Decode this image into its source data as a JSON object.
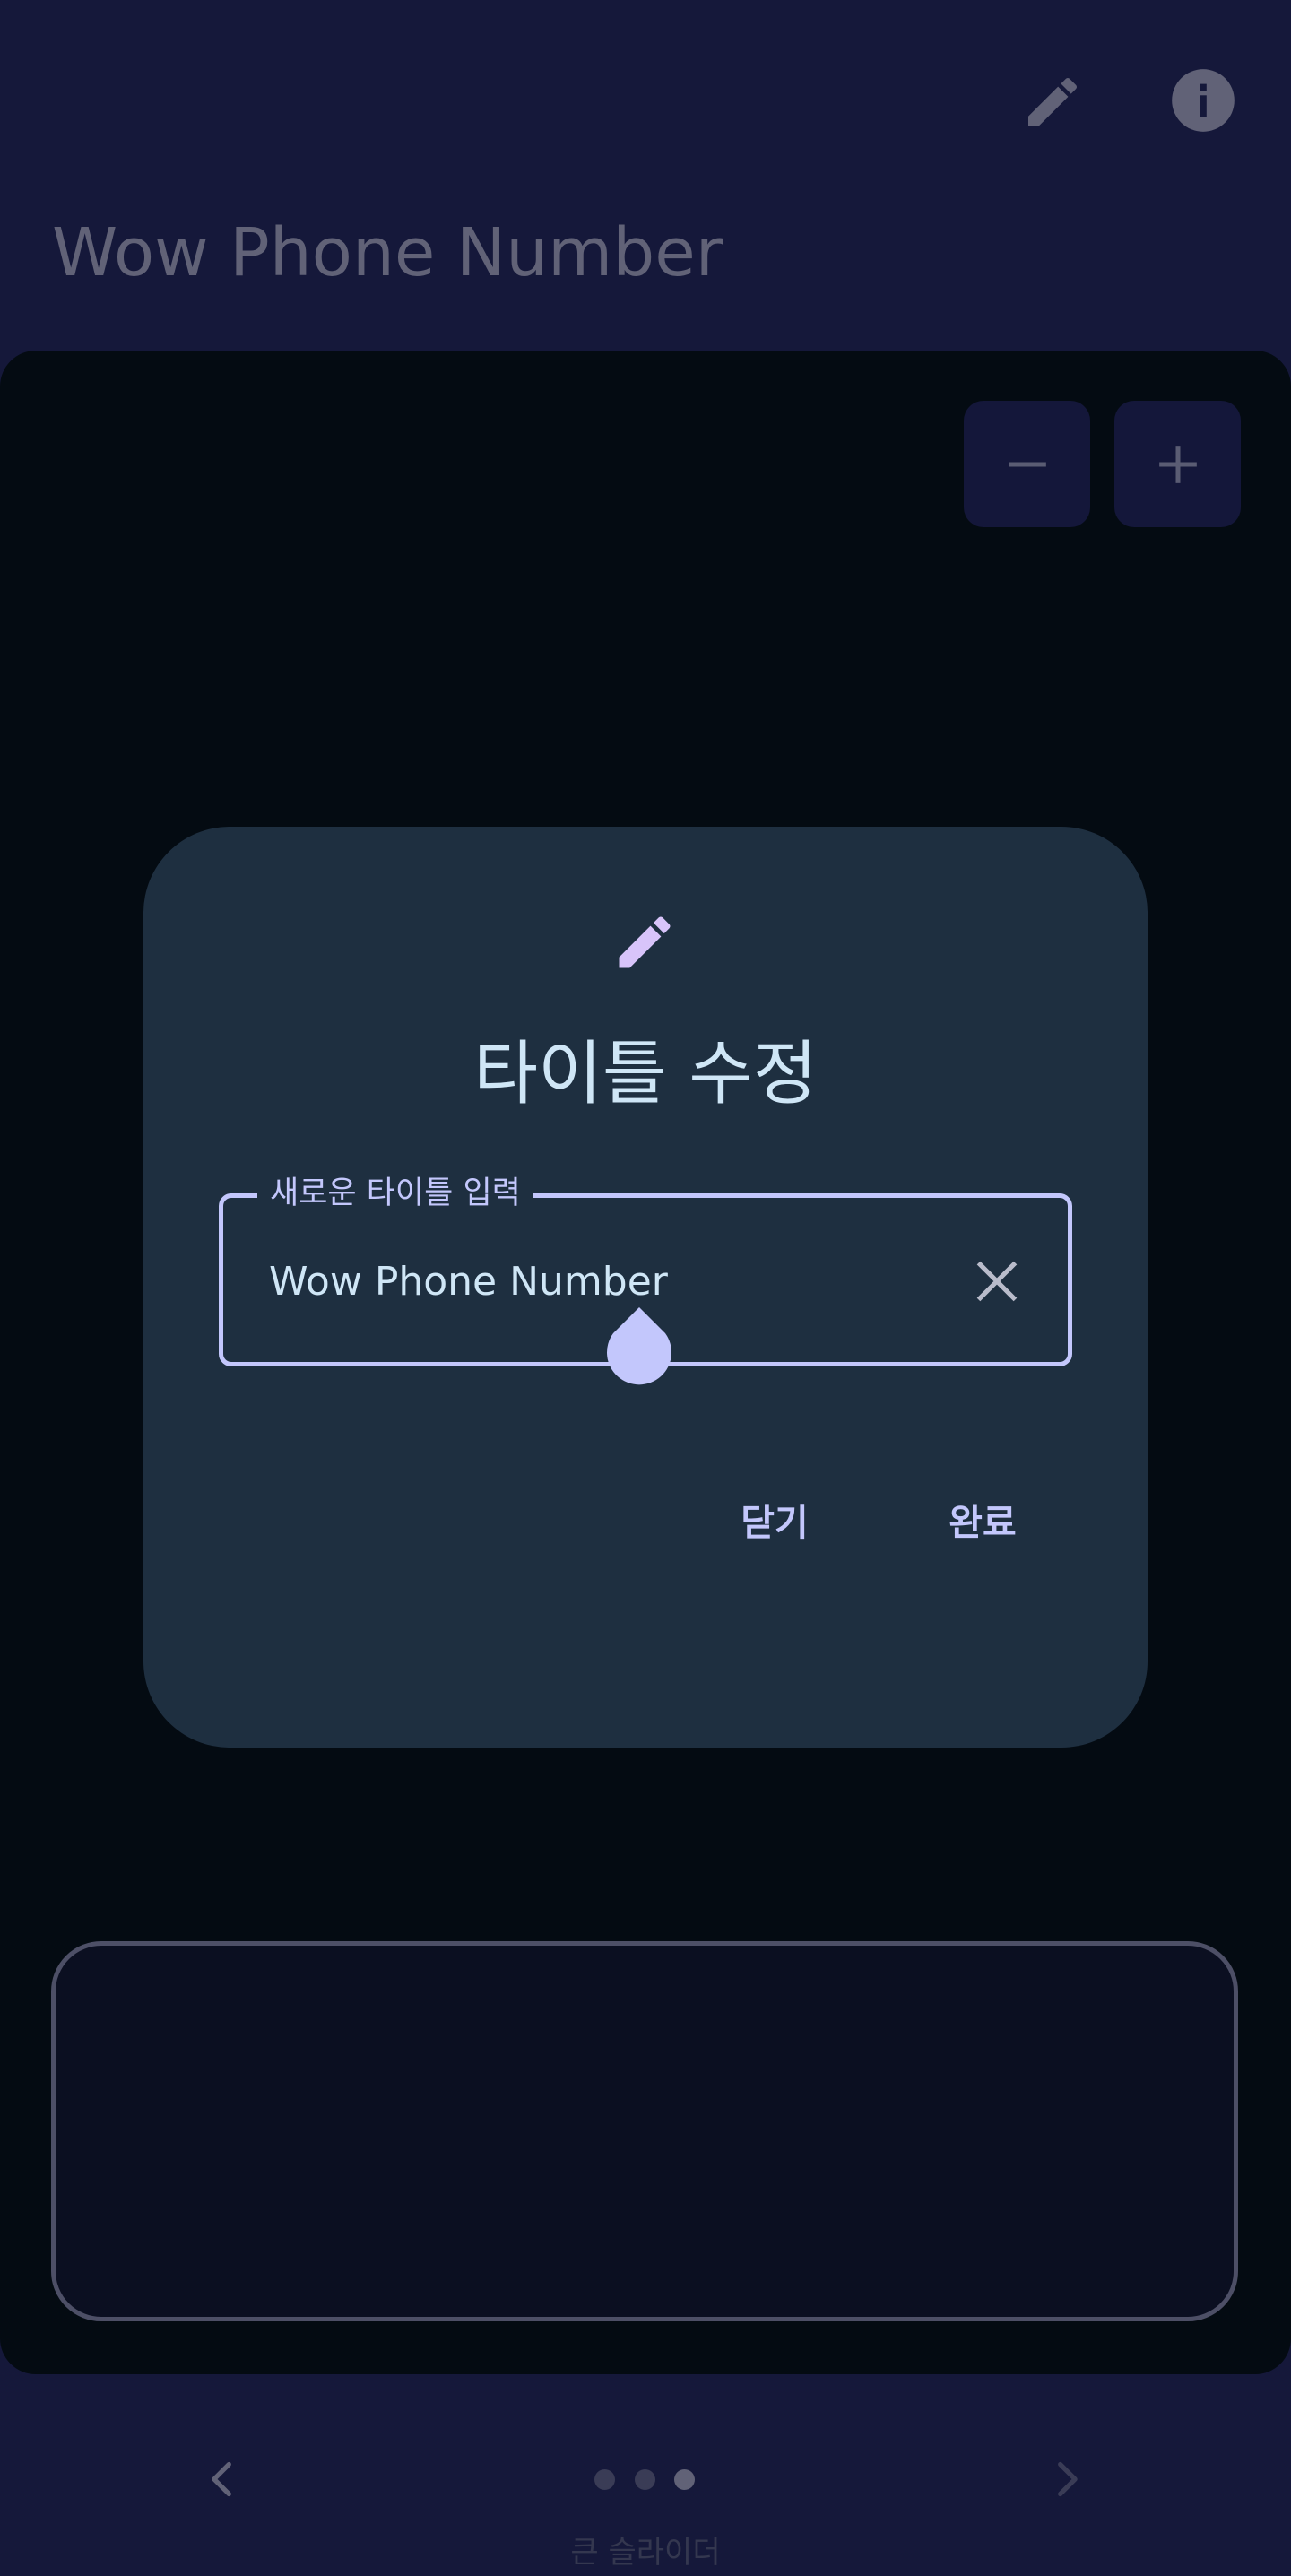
{
  "app": {
    "title": "Wow Phone Number"
  },
  "toolbar": {
    "edit_icon": "pencil-icon",
    "info_icon": "info-icon"
  },
  "zoom": {
    "out_icon": "minus-icon",
    "in_icon": "plus-icon"
  },
  "dialog": {
    "icon": "pencil-icon",
    "title": "타이틀 수정",
    "field": {
      "label": "새로운 타이틀 입력",
      "value": "Wow Phone Number",
      "clear_icon": "close-icon"
    },
    "buttons": {
      "close_label": "닫기",
      "done_label": "완료"
    }
  },
  "pager": {
    "prev_icon": "chevron-left-icon",
    "next_icon": "chevron-right-icon",
    "page_count": 3,
    "current_page": 3,
    "label": "큰 슬라이더"
  },
  "colors": {
    "background": "#15183a",
    "panel": "#040b12",
    "dialog": "#1e2f40",
    "accent": "#c3c7fc",
    "dialog_icon": "#d8c4fa",
    "title_text": "#cfe6f6",
    "muted": "#616277"
  }
}
